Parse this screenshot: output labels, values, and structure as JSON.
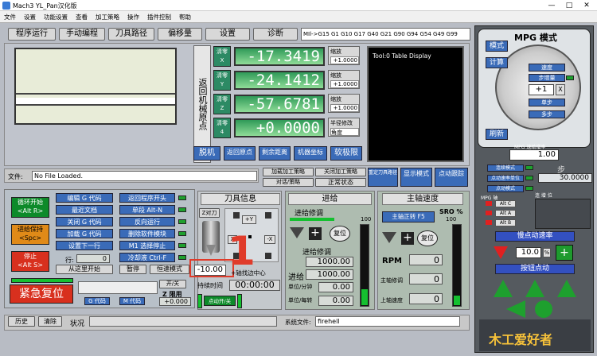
{
  "window": {
    "title": "Mach3 YL_Pan汉化版",
    "min": "—",
    "max": "□",
    "close": "✕"
  },
  "menu": [
    "文件",
    "设置",
    "功能设置",
    "查看",
    "加工策略",
    "操作",
    "插件控制",
    "帮助"
  ],
  "tabs": [
    "程序运行",
    "手动编程",
    "刀具路径",
    "偏移量",
    "设置",
    "诊断"
  ],
  "gcode_modal": "MIl->G15  G1 G10 G17 G40 G21 G90 G94 G54 G49 G99",
  "vertical_label": "返回机械原点",
  "axes": [
    {
      "zero_label": "清零",
      "axis": "X",
      "value": "-17.3419",
      "scale_label": "缩放",
      "scale": "+1.0000"
    },
    {
      "zero_label": "清零",
      "axis": "Y",
      "value": "-24.1412",
      "scale_label": "缩放",
      "scale": "+1.0000"
    },
    {
      "zero_label": "清零",
      "axis": "Z",
      "value": "-57.6781",
      "scale_label": "缩放",
      "scale": "+1.0000"
    },
    {
      "zero_label": "清零",
      "axis": "4",
      "value": "+0.0000",
      "scale_label": "半径修改",
      "scale": "角度"
    }
  ],
  "tool_display": "Tool:0    Table Display",
  "dro_buttons": [
    "脱机",
    "返回原点",
    "剩余距离",
    "机器坐标",
    "软极限"
  ],
  "file": {
    "label": "文件:",
    "value": "No File Loaded."
  },
  "file_buttons": {
    "load": "加载加工策略",
    "close": "关闭加工策略",
    "dialog": "对话/策略",
    "normal": "正常状态",
    "reset_tool": "重定刀具路径",
    "display": "显示模式",
    "jog_follow": "点动跟踪"
  },
  "cycle": {
    "start": "循环开始",
    "start_key": "<Alt R>",
    "feedhold": "进给保持",
    "feedhold_key": "<Spc>",
    "stop": "停止",
    "stop_key": "<Alt S>"
  },
  "program_buttons": [
    "编辑 G 代码",
    "最近文档",
    "关闭 G 代码",
    "加载 G 代码",
    "设置下一行"
  ],
  "mode_buttons": [
    "返回程序开头",
    "单段 Alt-N",
    "反向运行",
    "删除软件模块",
    "M1 选择停止",
    "冷却液 Ctrl-F"
  ],
  "line": {
    "label": "行:",
    "value": "0"
  },
  "run_from_here": "从这里开始",
  "pause_label": "暂停",
  "constant_velocity": "恒速模式",
  "emergency": "紧急复位",
  "gcodes_btn": "G 代码",
  "mcodes_btn": "M 代码",
  "z_inhibit": "Z 限用",
  "z_inhibit_val": "+0.000",
  "on_off": "开/关",
  "tool_info": {
    "title": "刀具信息",
    "z_touch": "Z对刀",
    "y_plus": "+Y",
    "y_minus": "-Y",
    "x_minus": "X",
    "x_plus": "-X",
    "value": "-10.00",
    "center": "+轴找边中心",
    "run_time_label": "持续时间",
    "run_time": "00:00:00",
    "jog_label": "点动开/关"
  },
  "overlay_number": "1",
  "feed": {
    "title": "进给",
    "override_label": "进给修调",
    "reset": "复位",
    "pct": "100",
    "units_label": "进给修调",
    "units_value": "1000.00",
    "feed_label": "进给",
    "feed_value": "1000.00",
    "per_min_label": "单位/分钟",
    "per_min": "0.00",
    "per_rev_label": "单位/每转",
    "per_rev": "0.00"
  },
  "spindle": {
    "title": "主轴速度",
    "cw_btn": "主轴正转 F5",
    "sro_label": "SRO %",
    "sro": "100",
    "reset": "复位",
    "rpm_label": "RPM",
    "rpm": "0",
    "set_label": "主轴修调",
    "set": "0",
    "upper_label": "上轴速度",
    "upper": "0"
  },
  "status": {
    "history": "历史",
    "clear": "清除",
    "status_label": "状况",
    "profile_label": "系统文件:",
    "profile": "firehell"
  },
  "mpg": {
    "title": "MPG 模式",
    "mode": "模式",
    "calc": "计算",
    "speed": "速度",
    "step": "步增量",
    "plus1": "+1",
    "x_btn": "X",
    "single": "单步",
    "multi": "多步",
    "refresh": "刷新",
    "fine": "MPG 速给增率",
    "fine_val": "1.00",
    "jog_mode": "连续模式",
    "step_label": "步",
    "feed_rate": "点动速率单位",
    "rate": "30.0000",
    "jog": "点动模式",
    "jog_mode_lbl": "点动模式",
    "status_title": "慢点动速率",
    "rate_pct": "10.0",
    "jog_btn": "按钮点动",
    "a_lbl": "Alt C",
    "b_lbl": "Alt A",
    "c_lbl": "Alt B",
    "mpg_lbl": "MPG 轴",
    "axes_header": "连 增 位",
    "logo": "木工爱好者"
  }
}
